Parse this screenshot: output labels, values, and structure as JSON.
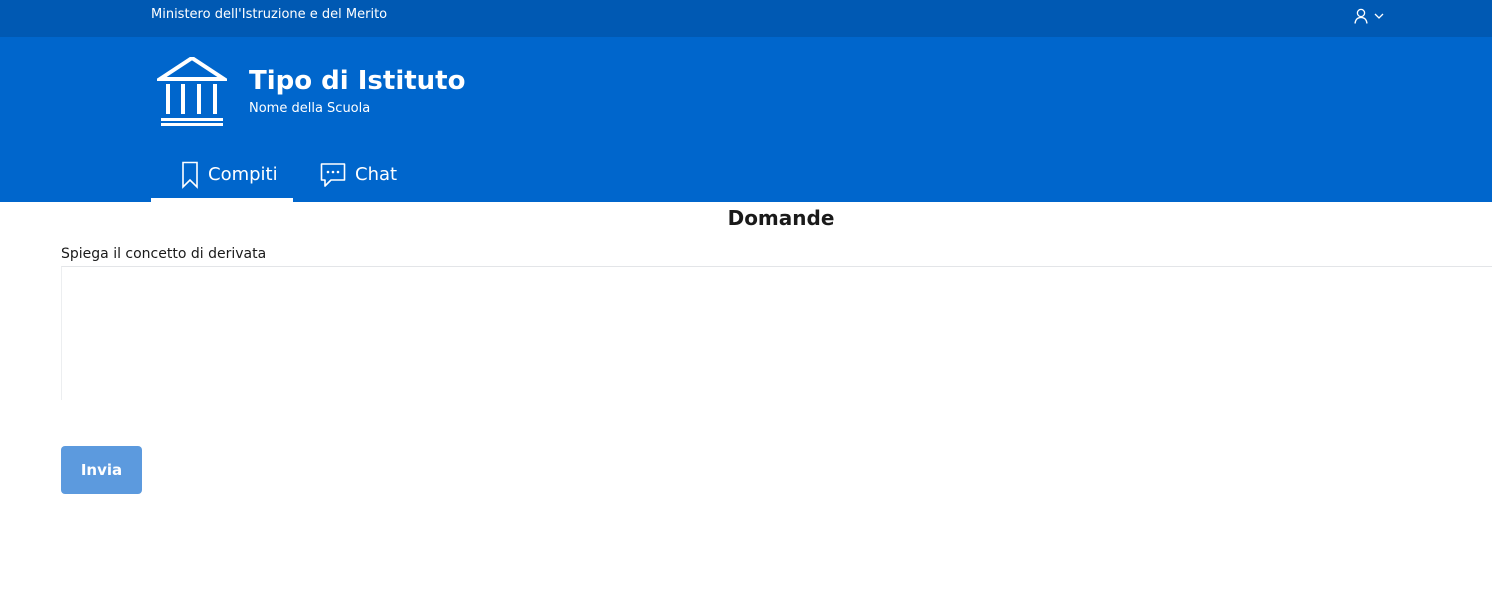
{
  "slim_header": {
    "title": "Ministero dell'Istruzione e del Merito",
    "user_icon": "user-icon",
    "dropdown_icon": "chevron-down-icon"
  },
  "brand": {
    "logo_icon": "institution-building-icon",
    "title": "Tipo di Istituto",
    "subtitle": "Nome della Scuola"
  },
  "nav": {
    "tabs": [
      {
        "label": "Compiti",
        "icon": "bookmark-icon",
        "active": true
      },
      {
        "label": "Chat",
        "icon": "chat-bubble-icon",
        "active": false
      }
    ]
  },
  "main": {
    "heading": "Domande",
    "question": "Spiega il concetto di derivata",
    "answer_value": "",
    "submit_label": "Invia"
  },
  "colors": {
    "slim_header_bg": "#0059b3",
    "header_bg": "#0066cc",
    "button_bg": "#5c9ade",
    "text_on_brand": "#ffffff"
  }
}
